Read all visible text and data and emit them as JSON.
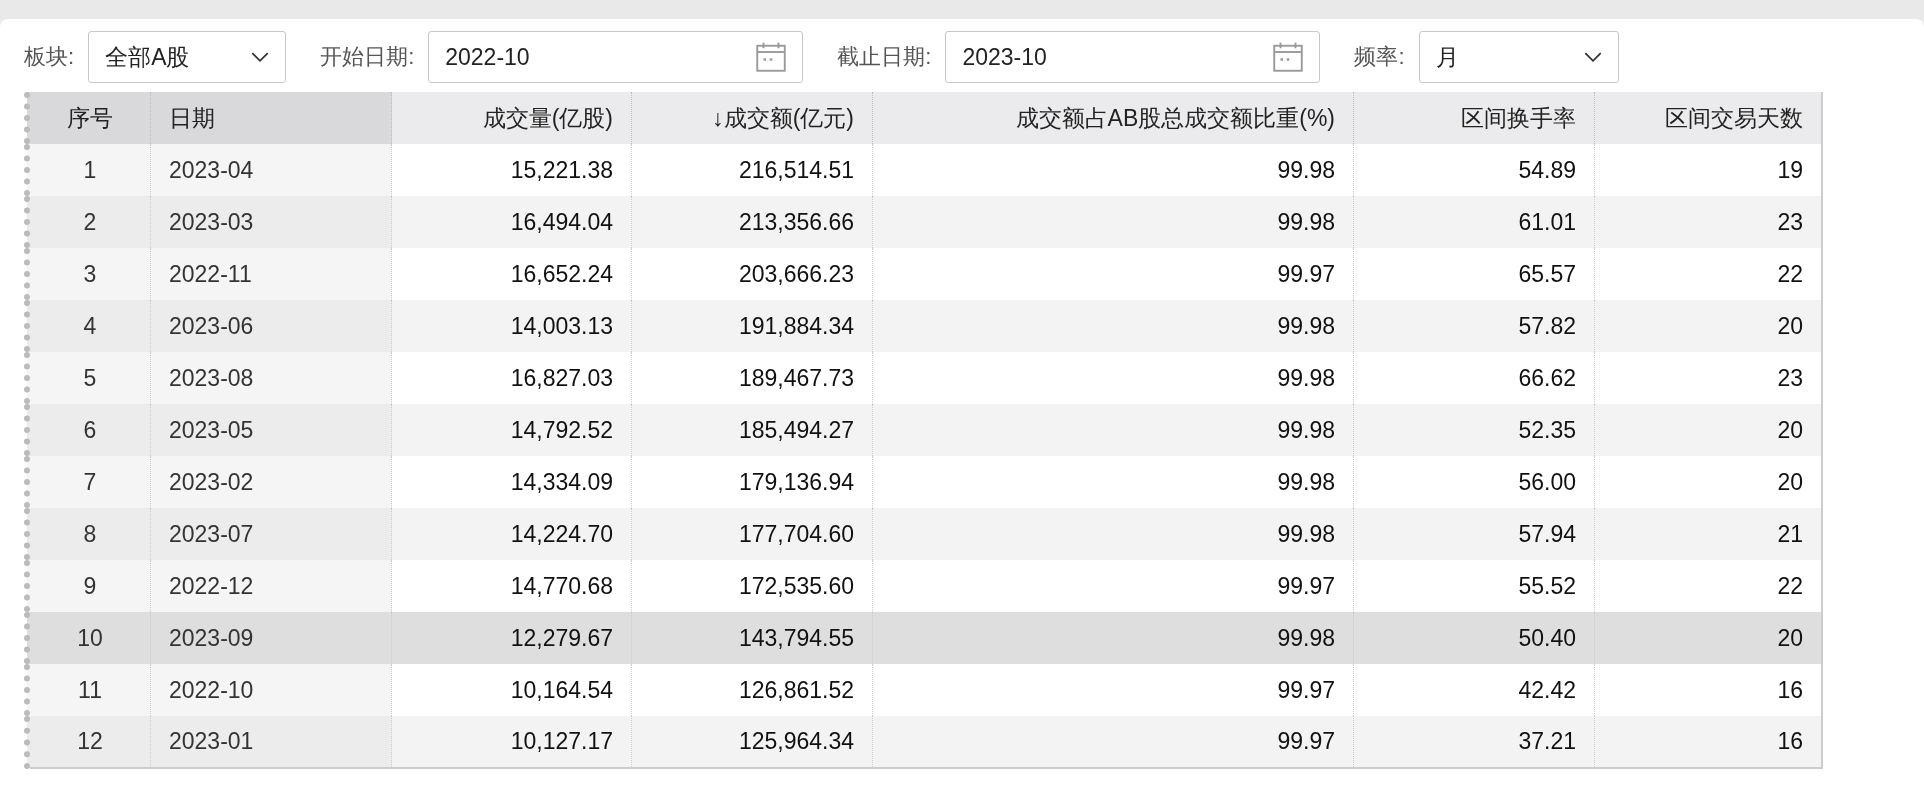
{
  "filters": [
    {
      "kind": "select",
      "label": "板块:",
      "value": "全部A股"
    },
    {
      "kind": "date",
      "label": "开始日期:",
      "value": "2022-10"
    },
    {
      "kind": "date",
      "label": "截止日期:",
      "value": "2023-10"
    },
    {
      "kind": "select",
      "label": "频率:",
      "value": "月"
    }
  ],
  "table": {
    "columns": [
      {
        "label": "序号",
        "kind": "index",
        "pinned": true
      },
      {
        "label": "日期",
        "kind": "date",
        "pinned": true
      },
      {
        "label": "成交量(亿股)",
        "kind": "number",
        "pinned": false
      },
      {
        "label": "↓成交额(亿元)",
        "kind": "number",
        "pinned": false
      },
      {
        "label": "成交额占AB股总成交额比重(%)",
        "kind": "number",
        "pinned": false
      },
      {
        "label": "区间换手率",
        "kind": "number",
        "pinned": false
      },
      {
        "label": "区间交易天数",
        "kind": "number",
        "pinned": false
      }
    ],
    "rows": [
      {
        "selected": false,
        "cells": [
          "1",
          "2023-04",
          "15,221.38",
          "216,514.51",
          "99.98",
          "54.89",
          "19"
        ]
      },
      {
        "selected": false,
        "cells": [
          "2",
          "2023-03",
          "16,494.04",
          "213,356.66",
          "99.98",
          "61.01",
          "23"
        ]
      },
      {
        "selected": false,
        "cells": [
          "3",
          "2022-11",
          "16,652.24",
          "203,666.23",
          "99.97",
          "65.57",
          "22"
        ]
      },
      {
        "selected": false,
        "cells": [
          "4",
          "2023-06",
          "14,003.13",
          "191,884.34",
          "99.98",
          "57.82",
          "20"
        ]
      },
      {
        "selected": false,
        "cells": [
          "5",
          "2023-08",
          "16,827.03",
          "189,467.73",
          "99.98",
          "66.62",
          "23"
        ]
      },
      {
        "selected": false,
        "cells": [
          "6",
          "2023-05",
          "14,792.52",
          "185,494.27",
          "99.98",
          "52.35",
          "20"
        ]
      },
      {
        "selected": false,
        "cells": [
          "7",
          "2023-02",
          "14,334.09",
          "179,136.94",
          "99.98",
          "56.00",
          "20"
        ]
      },
      {
        "selected": false,
        "cells": [
          "8",
          "2023-07",
          "14,224.70",
          "177,704.60",
          "99.98",
          "57.94",
          "21"
        ]
      },
      {
        "selected": false,
        "cells": [
          "9",
          "2022-12",
          "14,770.68",
          "172,535.60",
          "99.97",
          "55.52",
          "22"
        ]
      },
      {
        "selected": true,
        "cells": [
          "10",
          "2023-09",
          "12,279.67",
          "143,794.55",
          "99.98",
          "50.40",
          "20"
        ]
      },
      {
        "selected": false,
        "cells": [
          "11",
          "2022-10",
          "10,164.54",
          "126,861.52",
          "99.97",
          "42.42",
          "16"
        ]
      },
      {
        "selected": false,
        "cells": [
          "12",
          "2023-01",
          "10,127.17",
          "125,964.34",
          "99.97",
          "37.21",
          "16"
        ]
      }
    ]
  }
}
